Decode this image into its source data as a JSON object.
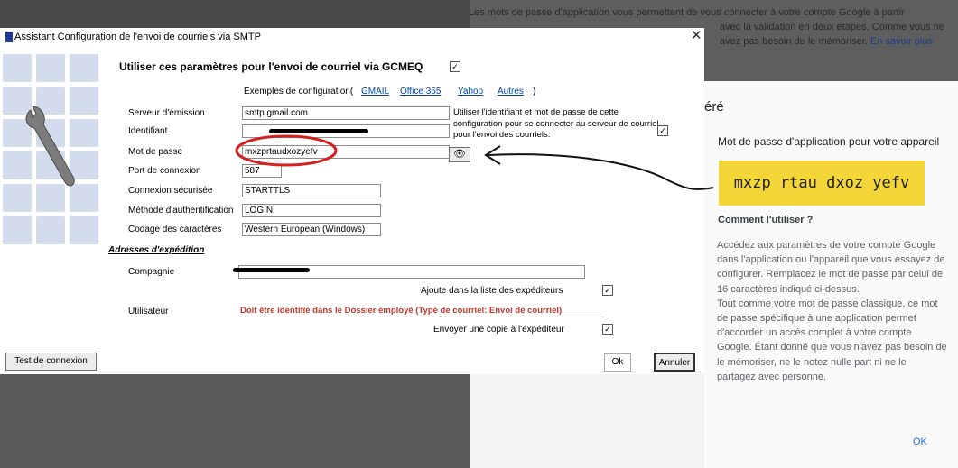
{
  "background": {
    "top_text_line1": "Les mots de passe d'application vous permettent de vous connecter à votre compte Google à partir",
    "top_text_line2": "avec la validation en deux étapes. Comme vous ne",
    "top_text_line3": "avez pas besoin de le mémoriser.",
    "top_text_link": "En savoir plus",
    "panel_heading_partial": "éré",
    "panel_subtitle": "Mot de passe d'application pour votre appareil",
    "app_password": "mxzp rtau dxoz yefv",
    "how_to_title": "Comment l'utiliser ?",
    "how_to_text": "Accédez aux paramètres de votre compte Google dans l'application ou l'appareil que vous essayez de configurer. Remplacez le mot de passe par celui de 16 caractères indiqué ci-dessus.",
    "how_to_text2": "Tout comme votre mot de passe classique, ce mot de passe spécifique à une application permet d'accorder un accès complet à votre compte Google. Étant donné que vous n'avez pas besoin de le mémoriser, ne le notez nulle part ni ne le partagez avec personne.",
    "ok_label": "OK"
  },
  "dialog": {
    "title": "Assistant Configuration de l'envoi de courriels via SMTP",
    "close_glyph": "✕",
    "heading": "Utiliser ces paramètres pour l'envoi de courriel via GCMEQ",
    "heading_checked": true,
    "examples_label": "Exemples de configuration(",
    "example_links": [
      "GMAIL",
      "Office 365",
      "Yahoo",
      "Autres"
    ],
    "examples_close": ")",
    "fields": {
      "server_label": "Serveur d'émission",
      "server_value": "smtp.gmail.com",
      "identifiant_label": "Identifiant",
      "password_label": "Mot de passe",
      "password_value": "mxzprtaudxozyefv",
      "port_label": "Port de connexion",
      "port_value": "587",
      "secure_label": "Connexion sécurisée",
      "secure_value": "STARTTLS",
      "auth_label": "Méthode d'authentification",
      "auth_value": "LOGIN",
      "charset_label": "Codage des caractères",
      "charset_value": "Western European (Windows)"
    },
    "use_identifier_text": "Utiliser l'identifiant et mot de passe de cette configuration pour se connecter au serveur de courriel pour l'envoi des courriels:",
    "use_identifier_checked": true,
    "show_password_glyph": "👁",
    "section_title": "Adresses d'expédition",
    "company_label": "Compagnie",
    "add_senders_label": "Ajoute dans la liste des expéditeurs",
    "add_senders_checked": true,
    "user_label": "Utilisateur",
    "user_value": "Doit être identifié dans le Dossier employé (Type de courriel: Envoi de courriel)",
    "send_copy_label": "Envoyer une copie à l'expéditeur",
    "send_copy_checked": true,
    "test_button": "Test de connexion",
    "ok_button": "Ok",
    "cancel_button": "Annuler"
  },
  "colors": {
    "highlight_yellow": "#f4d638",
    "annotation_red": "#d42020",
    "link_blue": "#0645ad",
    "error_red": "#c0392b"
  }
}
